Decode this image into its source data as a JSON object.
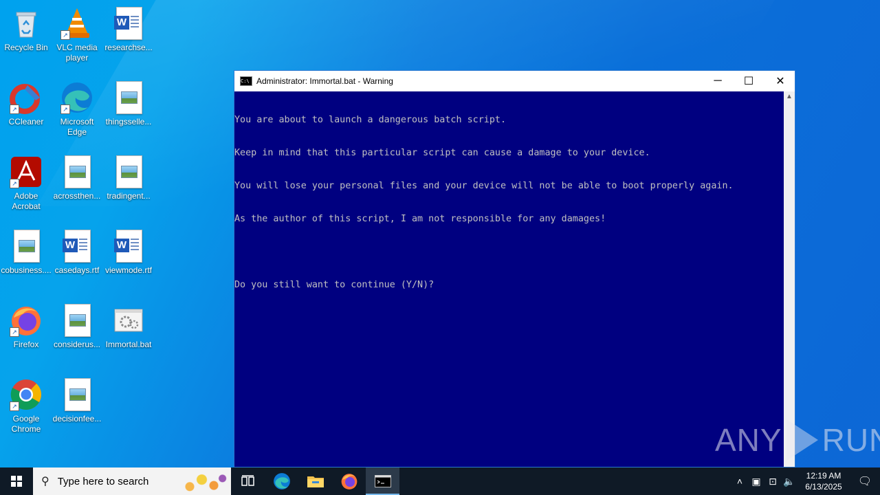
{
  "desktop": {
    "icons": [
      {
        "label": "Recycle Bin",
        "icon": "recycle-bin-icon"
      },
      {
        "label": "VLC media player",
        "icon": "vlc-icon"
      },
      {
        "label": "researchse...",
        "icon": "word-document-icon"
      },
      {
        "label": "CCleaner",
        "icon": "ccleaner-icon"
      },
      {
        "label": "Microsoft Edge",
        "icon": "edge-icon"
      },
      {
        "label": "thingsselle...",
        "icon": "image-file-icon"
      },
      {
        "label": "Adobe Acrobat",
        "icon": "acrobat-icon"
      },
      {
        "label": "acrossthen...",
        "icon": "image-file-icon"
      },
      {
        "label": "tradingent...",
        "icon": "image-file-icon"
      },
      {
        "label": "cobusiness....",
        "icon": "image-file-icon"
      },
      {
        "label": "casedays.rtf",
        "icon": "word-document-icon"
      },
      {
        "label": "viewmode.rtf",
        "icon": "word-document-icon"
      },
      {
        "label": "Firefox",
        "icon": "firefox-icon"
      },
      {
        "label": "considerus...",
        "icon": "image-file-icon"
      },
      {
        "label": "Immortal.bat",
        "icon": "batch-file-icon"
      },
      {
        "label": "Google Chrome",
        "icon": "chrome-icon"
      },
      {
        "label": "decisionfee...",
        "icon": "image-file-icon"
      }
    ]
  },
  "window": {
    "title": "Administrator:  Immortal.bat - Warning",
    "minimize_glyph": "─",
    "maximize_glyph": "☐",
    "close_glyph": "✕",
    "console_lines": [
      "You are about to launch a dangerous batch script.",
      "Keep in mind that this particular script can cause a damage to your device.",
      "You will lose your personal files and your device will not be able to boot properly again.",
      "As the author of this script, I am not responsible for any damages!",
      "",
      "Do you still want to continue (Y/N)?"
    ]
  },
  "watermark": {
    "left": "ANY",
    "right": "RUN"
  },
  "taskbar": {
    "search_placeholder": "Type here to search",
    "clock_time": "12:19 AM",
    "clock_date": "6/13/2025"
  },
  "colors": {
    "console_bg": "#000080",
    "console_fg": "#c0c0c0",
    "taskbar_bg": "#0f1a26"
  }
}
